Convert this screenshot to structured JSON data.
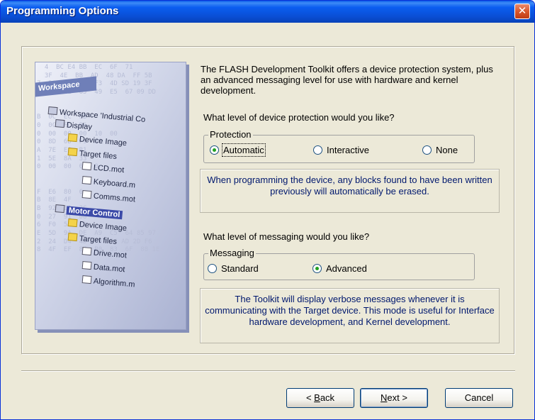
{
  "window": {
    "title": "Programming Options",
    "close_glyph": "✕"
  },
  "artwork": {
    "workspace_title": "Workspace",
    "hex_lines": [
      "  4  BC E4 BB  EC  6F  71  ",
      "  3F  4E  BB  AD  48 DA  FF 5B",
      "7  2A  9A  2E  F3  4D SD 19 3F",
      "B  4B  CE  65  49  E5  67 09 DD",
      "",
      "",
      "B  0C  EC  8B",
      "0  0C  FC  96",
      "0  00  00  00  10  00",
      "0  8D  6D  F9  80",
      "A  7E  E8  B1",
      "1  5E  8A  33",
      "0  00  00  00  0",
      "",
      "",
      "F  E6  80  6",
      "B  8E  4F",
      "B  92  1A  2C",
      "0  27  91  08",
      "6  F0  58  FD",
      "E  5D  9A  DE  A9  C5  64 85 97",
      "2  24  D4  4D  75  54 AD 2D F6",
      "8  4F  EF  84  B0  83  6F  88 1E"
    ],
    "tree": {
      "root": "Workspace 'Industrial Co",
      "display": "Display",
      "device_image_1": "Device Image",
      "target_files_1": "Target files",
      "lcd": "LCD.mot",
      "keyboard": "Keyboard.m",
      "comms": "Comms.mot",
      "motor": "Motor Control",
      "device_image_2": "Device Image",
      "target_files_2": "Target files",
      "drive": "Drive.mot",
      "data": "Data.mot",
      "algorithm": "Algorithm.m"
    }
  },
  "intro_text": "The FLASH Development Toolkit offers a device protection system, plus an advanced messaging level for use with hardware and kernel development.",
  "protection": {
    "question": "What level of device protection would you like?",
    "group_label": "Protection",
    "options": [
      "Automatic",
      "Interactive",
      "None"
    ],
    "selected": "Automatic",
    "info": "When programming the device, any blocks found to have been written previously will automatically be erased."
  },
  "messaging": {
    "question": "What level of messaging would you like?",
    "group_label": "Messaging",
    "options": [
      "Standard",
      "Advanced"
    ],
    "selected": "Advanced",
    "info": "The Toolkit will display verbose messages whenever it is communicating with the Target device. This mode is useful for Interface hardware development, and Kernel development."
  },
  "buttons": {
    "back_prefix": "< ",
    "back_hotkey": "B",
    "back_rest": "ack",
    "next_hotkey": "N",
    "next_rest": "ext >",
    "cancel": "Cancel"
  },
  "colors": {
    "title_bar": "#0a4fd6",
    "info_text": "#00186e",
    "dialog_bg": "#ece9d8",
    "radio_dot": "#21a121"
  }
}
